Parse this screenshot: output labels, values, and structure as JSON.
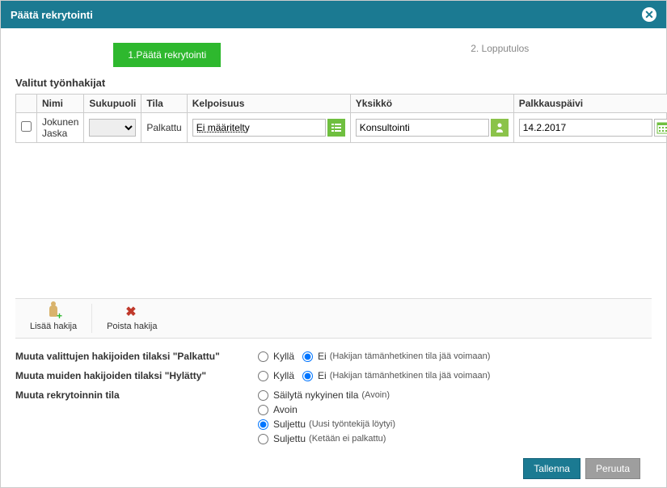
{
  "dialog": {
    "title": "Päätä rekrytointi",
    "step1": "1.Päätä rekrytointi",
    "step2": "2. Lopputulos"
  },
  "section_title": "Valitut työnhakijat",
  "table": {
    "headers": {
      "nimi": "Nimi",
      "sukupuoli": "Sukupuoli",
      "tila": "Tila",
      "kelpoisuus": "Kelpoisuus",
      "yksikko": "Yksikkö",
      "palkkauspaivi": "Palkkauspäivi"
    },
    "row": {
      "nimi": "Jokunen Jaska",
      "tila": "Palkattu",
      "kelpoisuus": "Ei määritelty",
      "yksikko": "Konsultointi",
      "palkkauspaivi": "14.2.2017"
    }
  },
  "toolbar": {
    "add": "Lisää hakija",
    "remove": "Poista hakija"
  },
  "options": {
    "label_palkattu": "Muuta valittujen hakijoiden tilaksi \"Palkattu\"",
    "label_hylatty": "Muuta muiden hakijoiden tilaksi \"Hylätty\"",
    "label_rekrytila": "Muuta rekrytoinnin tila",
    "kylla": "Kyllä",
    "ei": "Ei",
    "hint_voimaan": "(Hakijan tämänhetkinen tila jää voimaan)",
    "sailyta": "Säilytä nykyinen tila",
    "sailyta_hint": "(Avoin)",
    "avoin": "Avoin",
    "suljettu_loytyi": "Suljettu",
    "suljettu_loytyi_hint": "(Uusi työntekijä löytyi)",
    "suljettu_ei": "Suljettu",
    "suljettu_ei_hint": "(Ketään ei palkattu)"
  },
  "footer": {
    "save": "Tallenna",
    "cancel": "Peruuta"
  }
}
